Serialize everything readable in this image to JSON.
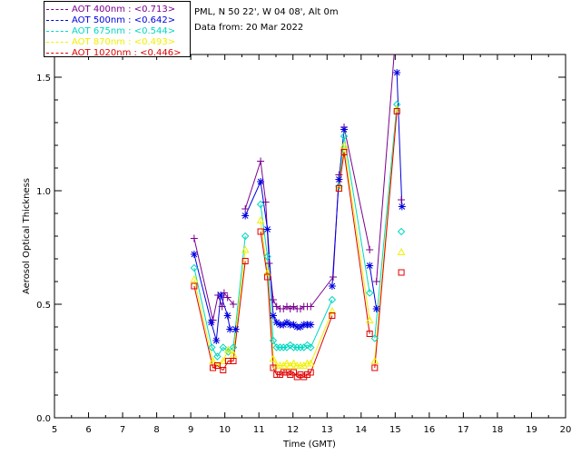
{
  "legend": [
    {
      "label": "AOT  400nm : <0.713>",
      "color": "#7a0090"
    },
    {
      "label": "AOT  500nm : <0.642>",
      "color": "#0000e0"
    },
    {
      "label": "AOT  675nm : <0.544>",
      "color": "#00d8c0"
    },
    {
      "label": "AOT  870nm : <0.493>",
      "color": "#f0f000"
    },
    {
      "label": "AOT 1020nm : <0.446>",
      "color": "#e00000"
    }
  ],
  "info": {
    "site": "PML, N 50 22', W 04 08', Alt 0m",
    "date": "Data from: 20 Mar 2022"
  },
  "chart_data": {
    "type": "scatter",
    "xlabel": "Time (GMT)",
    "ylabel": "Aerosol Optical Thickness",
    "xlim": [
      5,
      20
    ],
    "ylim": [
      0,
      1.6
    ],
    "xticks": [
      5,
      6,
      7,
      8,
      9,
      10,
      11,
      12,
      13,
      14,
      15,
      16,
      17,
      18,
      19,
      20
    ],
    "yticks": [
      0.0,
      0.5,
      1.0,
      1.5
    ],
    "ytick_labels": [
      "0.0",
      "0.5",
      "1.0",
      "1.5"
    ],
    "series": [
      {
        "name": "AOT  400nm",
        "marker": "plus",
        "color": "#7a0090",
        "points": [
          [
            9.1,
            0.79
          ],
          [
            9.65,
            0.43
          ],
          [
            9.8,
            0.54
          ],
          [
            9.92,
            0.49
          ],
          [
            9.98,
            0.55
          ],
          [
            10.08,
            0.53
          ],
          [
            10.25,
            0.5
          ],
          [
            10.6,
            0.92
          ],
          [
            11.05,
            1.13
          ],
          [
            11.2,
            0.95
          ],
          [
            11.3,
            0.68
          ],
          [
            11.42,
            0.52
          ],
          [
            11.52,
            0.49
          ],
          [
            11.62,
            0.48
          ],
          [
            11.72,
            0.48
          ],
          [
            11.82,
            0.49
          ],
          [
            11.92,
            0.48
          ],
          [
            12.02,
            0.49
          ],
          [
            12.12,
            0.48
          ],
          [
            12.22,
            0.48
          ],
          [
            12.32,
            0.49
          ],
          [
            12.42,
            0.49
          ],
          [
            12.52,
            0.49
          ],
          [
            13.18,
            0.62
          ],
          [
            13.35,
            1.07
          ],
          [
            13.5,
            1.28
          ],
          [
            14.25,
            0.74
          ],
          [
            14.45,
            0.6
          ],
          [
            15.02,
            1.7
          ],
          [
            15.18,
            0.96
          ]
        ]
      },
      {
        "name": "AOT  500nm",
        "marker": "star",
        "color": "#0000e0",
        "points": [
          [
            9.1,
            0.72
          ],
          [
            9.6,
            0.42
          ],
          [
            9.75,
            0.34
          ],
          [
            9.88,
            0.54
          ],
          [
            10.08,
            0.45
          ],
          [
            10.15,
            0.39
          ],
          [
            10.32,
            0.39
          ],
          [
            10.6,
            0.89
          ],
          [
            11.05,
            1.04
          ],
          [
            11.25,
            0.83
          ],
          [
            11.42,
            0.45
          ],
          [
            11.52,
            0.42
          ],
          [
            11.62,
            0.41
          ],
          [
            11.72,
            0.41
          ],
          [
            11.82,
            0.42
          ],
          [
            11.92,
            0.41
          ],
          [
            12.02,
            0.41
          ],
          [
            12.12,
            0.4
          ],
          [
            12.22,
            0.4
          ],
          [
            12.32,
            0.41
          ],
          [
            12.42,
            0.41
          ],
          [
            12.52,
            0.41
          ],
          [
            13.15,
            0.58
          ],
          [
            13.35,
            1.05
          ],
          [
            13.5,
            1.27
          ],
          [
            14.25,
            0.67
          ],
          [
            14.45,
            0.48
          ],
          [
            15.05,
            1.52
          ],
          [
            15.2,
            0.93
          ]
        ]
      },
      {
        "name": "AOT  675nm",
        "marker": "diamond",
        "color": "#00d8c0",
        "points": [
          [
            9.1,
            0.66
          ],
          [
            9.62,
            0.31
          ],
          [
            9.78,
            0.27
          ],
          [
            9.95,
            0.31
          ],
          [
            10.1,
            0.29
          ],
          [
            10.25,
            0.31
          ],
          [
            10.6,
            0.8
          ],
          [
            11.05,
            0.94
          ],
          [
            11.25,
            0.71
          ],
          [
            11.42,
            0.34
          ],
          [
            11.52,
            0.31
          ],
          [
            11.62,
            0.31
          ],
          [
            11.72,
            0.31
          ],
          [
            11.82,
            0.31
          ],
          [
            11.92,
            0.32
          ],
          [
            12.02,
            0.31
          ],
          [
            12.12,
            0.31
          ],
          [
            12.22,
            0.31
          ],
          [
            12.32,
            0.31
          ],
          [
            12.42,
            0.32
          ],
          [
            12.52,
            0.31
          ],
          [
            13.15,
            0.52
          ],
          [
            13.35,
            1.02
          ],
          [
            13.5,
            1.24
          ],
          [
            14.25,
            0.55
          ],
          [
            14.4,
            0.35
          ],
          [
            15.05,
            1.38
          ],
          [
            15.18,
            0.82
          ]
        ]
      },
      {
        "name": "AOT  870nm",
        "marker": "triangle",
        "color": "#f0f000",
        "points": [
          [
            9.1,
            0.61
          ],
          [
            9.65,
            0.25
          ],
          [
            9.78,
            0.23
          ],
          [
            9.95,
            0.25
          ],
          [
            10.1,
            0.3
          ],
          [
            10.25,
            0.28
          ],
          [
            10.6,
            0.74
          ],
          [
            11.05,
            0.87
          ],
          [
            11.25,
            0.64
          ],
          [
            11.42,
            0.26
          ],
          [
            11.52,
            0.23
          ],
          [
            11.62,
            0.23
          ],
          [
            11.72,
            0.23
          ],
          [
            11.82,
            0.24
          ],
          [
            11.92,
            0.23
          ],
          [
            12.02,
            0.24
          ],
          [
            12.12,
            0.23
          ],
          [
            12.22,
            0.23
          ],
          [
            12.32,
            0.23
          ],
          [
            12.42,
            0.24
          ],
          [
            12.52,
            0.24
          ],
          [
            13.15,
            0.47
          ],
          [
            13.35,
            1.01
          ],
          [
            13.5,
            1.2
          ],
          [
            14.25,
            0.43
          ],
          [
            14.4,
            0.25
          ],
          [
            15.05,
            1.36
          ],
          [
            15.18,
            0.73
          ]
        ]
      },
      {
        "name": "AOT 1020nm",
        "marker": "square",
        "color": "#e00000",
        "points": [
          [
            9.1,
            0.58
          ],
          [
            9.65,
            0.22
          ],
          [
            9.78,
            0.23
          ],
          [
            9.95,
            0.21
          ],
          [
            10.1,
            0.25
          ],
          [
            10.25,
            0.25
          ],
          [
            10.6,
            0.69
          ],
          [
            11.05,
            0.82
          ],
          [
            11.25,
            0.62
          ],
          [
            11.42,
            0.22
          ],
          [
            11.52,
            0.19
          ],
          [
            11.62,
            0.19
          ],
          [
            11.72,
            0.2
          ],
          [
            11.82,
            0.2
          ],
          [
            11.92,
            0.19
          ],
          [
            12.02,
            0.2
          ],
          [
            12.12,
            0.18
          ],
          [
            12.22,
            0.19
          ],
          [
            12.32,
            0.18
          ],
          [
            12.42,
            0.19
          ],
          [
            12.52,
            0.2
          ],
          [
            13.15,
            0.45
          ],
          [
            13.35,
            1.01
          ],
          [
            13.5,
            1.17
          ],
          [
            14.25,
            0.37
          ],
          [
            14.4,
            0.22
          ],
          [
            15.05,
            1.35
          ],
          [
            15.18,
            0.64
          ]
        ]
      }
    ],
    "segments": [
      [
        0,
        7
      ],
      [
        7,
        22
      ],
      [
        22,
        25
      ],
      [
        25,
        27
      ],
      [
        27,
        29
      ]
    ]
  }
}
